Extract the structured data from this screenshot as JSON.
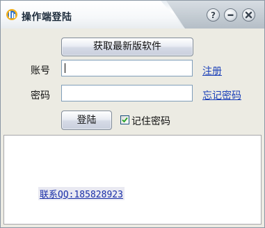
{
  "window": {
    "title": "操作端登陆",
    "controls": {
      "help_icon": "help-icon",
      "minimize_icon": "minimize-icon",
      "close_icon": "close-icon"
    }
  },
  "update_button": {
    "label": "获取最新版软件"
  },
  "account": {
    "label": "账号",
    "value": "",
    "link": "注册"
  },
  "password": {
    "label": "密码",
    "value": "",
    "link": "忘记密码"
  },
  "login_button": {
    "label": "登陆"
  },
  "remember": {
    "label": "记住密码",
    "checked": true
  },
  "info": {
    "contact": "联系QQ:185828923"
  },
  "colors": {
    "link": "#1a3fb8",
    "window_bg": "#ecebe3",
    "input_border": "#7f9db9"
  }
}
